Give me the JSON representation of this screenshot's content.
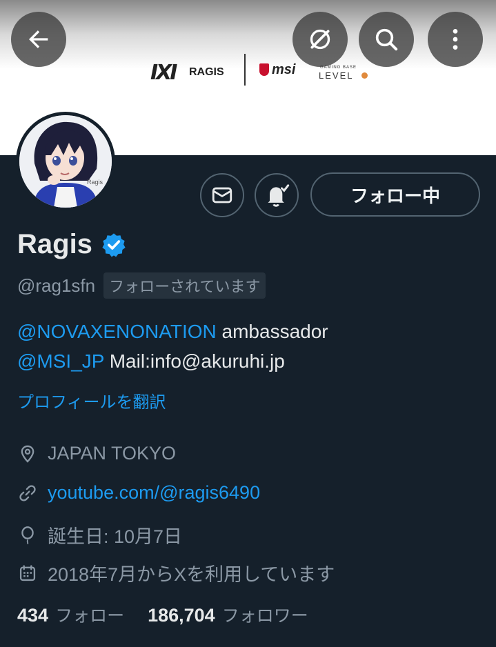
{
  "banner": {
    "sponsor_logo1": "IXI",
    "sponsor_ragis": "RAGIS",
    "sponsor_msi": "msi",
    "sponsor_gaming": "GAMING BASE",
    "sponsor_level": "LEVEL"
  },
  "header_buttons": {
    "back": "back-arrow-icon",
    "grok": "grok-icon",
    "search": "search-icon",
    "more": "more-vertical-icon"
  },
  "avatar": {
    "caption": "Ragis"
  },
  "actions": {
    "follow_label": "フォロー中"
  },
  "profile": {
    "name": "Ragis",
    "handle": "@rag1sfn",
    "follows_you": "フォローされています",
    "bio_line1_mention": "@NOVAXENONATION",
    "bio_line1_text": " ambassador",
    "bio_line2_mention": "@MSI_JP",
    "bio_line2_text": " Mail:info@akuruhi.jp",
    "translate": "プロフィールを翻訳",
    "location": "JAPAN TOKYO",
    "link": "youtube.com/@ragis6490",
    "birthday": "誕生日: 10月7日",
    "joined": "2018年7月からXを利用しています"
  },
  "stats": {
    "following_count": "434",
    "following_label": "フォロー",
    "followers_count": "186,704",
    "followers_label": "フォロワー"
  },
  "colors": {
    "background": "#15202b",
    "accent": "#1d9bf0",
    "secondary_text": "#8b98a5"
  }
}
